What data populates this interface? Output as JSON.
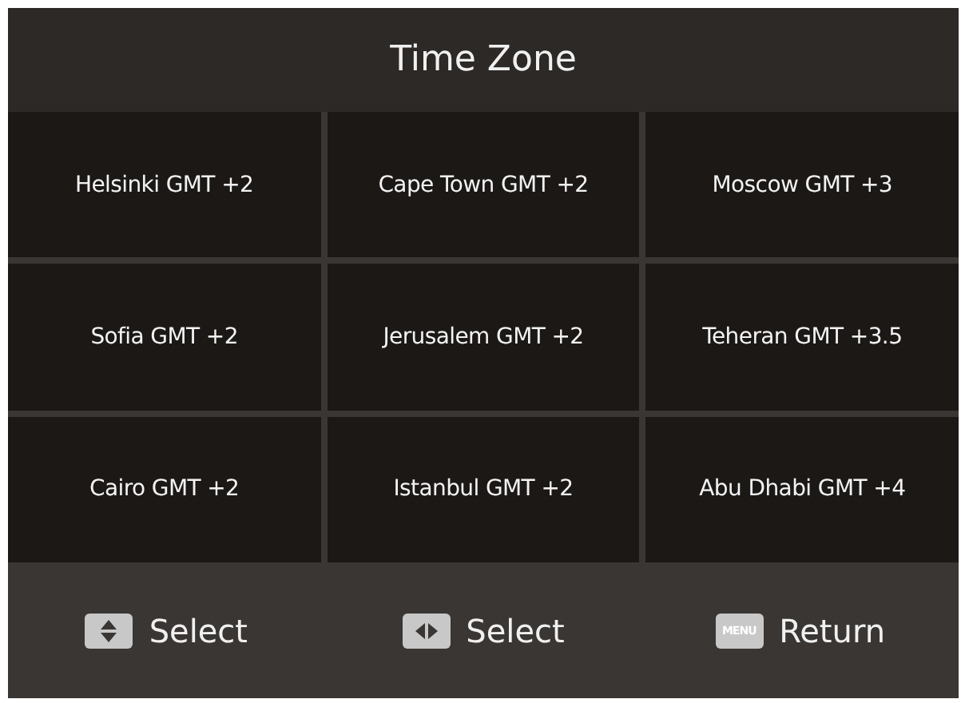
{
  "title": "Time Zone",
  "zones": [
    {
      "label": "Helsinki GMT +2"
    },
    {
      "label": "Cape Town GMT +2"
    },
    {
      "label": "Moscow GMT +3"
    },
    {
      "label": "Sofia GMT +2"
    },
    {
      "label": "Jerusalem GMT +2"
    },
    {
      "label": "Teheran GMT +3.5"
    },
    {
      "label": "Cairo GMT +2"
    },
    {
      "label": "Istanbul GMT +2"
    },
    {
      "label": "Abu Dhabi GMT +4"
    }
  ],
  "hints": [
    {
      "kind": "updown",
      "label": "Select"
    },
    {
      "kind": "leftright",
      "label": "Select"
    },
    {
      "kind": "menu",
      "key": "MENU",
      "label": "Return"
    }
  ]
}
